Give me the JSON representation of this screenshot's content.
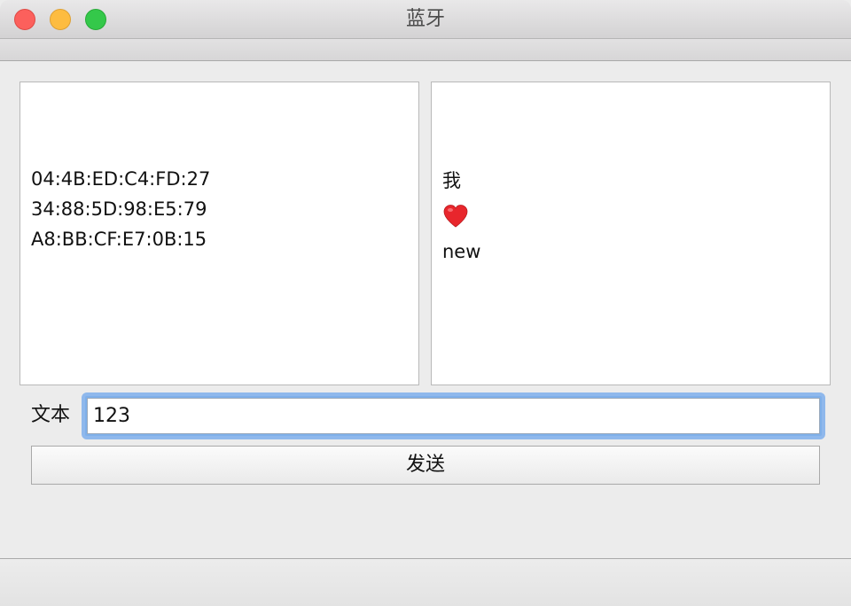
{
  "window": {
    "title": "蓝牙"
  },
  "devices": {
    "items": [
      "04:4B:ED:C4:FD:27",
      "34:88:5D:98:E5:79",
      "A8:BB:CF:E7:0B:15"
    ]
  },
  "messages": {
    "items": [
      {
        "type": "text",
        "value": "我"
      },
      {
        "type": "icon",
        "value": "heart-icon"
      },
      {
        "type": "text",
        "value": "new"
      }
    ],
    "texts": [
      "我",
      "new"
    ]
  },
  "input": {
    "label": "文本",
    "value": "123"
  },
  "actions": {
    "send_label": "发送"
  },
  "colors": {
    "focus_ring": "#8fb8ec",
    "heart": "#e8262c",
    "close_button": "#fc605c",
    "minimize_button": "#fdbc40",
    "zoom_button": "#34c84a"
  }
}
